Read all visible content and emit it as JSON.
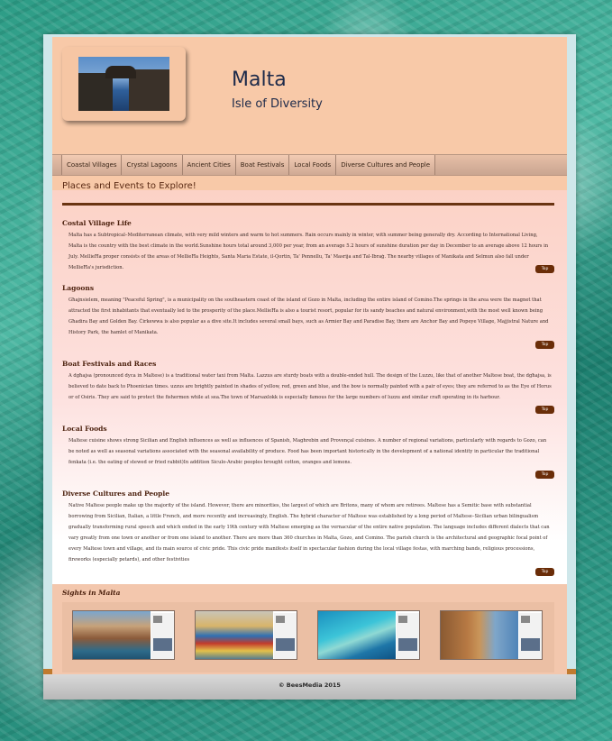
{
  "header": {
    "title": "Malta",
    "subtitle": "Isle of Diversity"
  },
  "nav": {
    "items": [
      "Coastal Villages",
      "Crystal Lagoons",
      "Ancient Cities",
      "Boat Festivals",
      "Local Foods",
      "Diverse Cultures and People"
    ]
  },
  "main": {
    "places_heading": "Places and Events to Explore!",
    "top_label": "Top",
    "sections": [
      {
        "heading": "Costal Village Life",
        "text": "Malta has a Subtropical–Mediterranean climate, with very mild winters and warm to hot summers. Rain occurs mainly in winter, with summer being generally dry. According to International Living, Malta is the country with the best climate in the world.Sunshine hours total around 3,000 per year, from an average 5.2 hours of sunshine duration per day in December to an average above 12 hours in July. MellieĦa proper consists of the areas of MellieĦa Heights, Santa Maria Estate, il-Qortin, Ta' Pennellu, Ta' Masrija and Tal-Ibraġ. The nearby villages of Manikata and Selmun also fall under MellieĦa's jurisdiction."
      },
      {
        "heading": "Lagoons",
        "text": "Għajnsielem, meaning \"Peaceful Spring\", is a municipality on the southeastern coast of the island of Gozo in Malta, including the entire island of Comino.The springs in the area were the magnet that attracted the first inhabitants that eventually led to the prosperity of the place.MellieĦa is also a tourist resort, popular for its sandy beaches and natural environment,with the most well known being Għadira Bay and Golden Bay. Ċirkewwa is also popular as a dive site.It includes several small bays, such as Armier Bay and Paradise Bay, there are Anchor Bay and Popeye Village, Majjistral Nature and History Park, the hamlet of Manikata."
      },
      {
        "heading": "Boat Festivals and Races",
        "text": "A dgħajsa (pronounced dyса in Maltese) is a traditional water taxi from Malta. Lazzus are sturdy boats with a double-ended hull. The design of the Luzzu, like that of another Maltese boat, the dgħajsa, is believed to date back to Phoenician times. uzzus are brightly painted in shades of yellow, red, green and blue, and the bow is normally painted with a pair of eyes; they are referred to as the Eye of Horus or of Osiris. They are said to protect the fishermen while at sea.The town of Marsaxlokk is especially famous for the large numbers of luzzu and similar craft operating in its harbour."
      },
      {
        "heading": "Local Foods",
        "text": "Maltese cuisine shows strong Sicilian and English influences as well as influences of Spanish, Maghrebin and Provençal cuisines. A number of regional variations, particularly with regards to Gozo, can be noted as well as seasonal variations associated with the seasonal availability of produce. Food has been important historically in the development of a national identity in particular the traditional fenkata (i.e. the eating of stewed or fried rabbit)In addition Siculo-Arabic peoples brought cotton, oranges and lemons."
      },
      {
        "heading": "Diverse Cultures and People",
        "text": "Native Maltese people make up the majority of the island. However, there are minorities, the largest of which are Britons, many of whom are retirees. Maltese has a Semitic base with substantial borrowing from Sicilian, Italian, a little French, and more recently and increasingly, English. The hybrid character of Maltese was established by a long period of Maltese–Sicilian urban bilingualism gradually transforming rural speech and which ended in the early 19th century with Maltese emerging as the vernacular of the entire native population. The language includes different dialects that can vary greatly from one town or another or from one island to another. There are more than 360 churches in Malta, Gozo, and Comino. The parish church is the architectural and geographic focal point of every Maltese town and village, and its main source of civic pride. This civic pride manifests itself in spectacular fashion during the local village festas, with marching bands, religious processions, fireworks (especially petards), and other festivities"
      }
    ]
  },
  "sights": {
    "heading": "Sights in Malta"
  },
  "footer": {
    "text": "© BeesMedia 2015"
  }
}
